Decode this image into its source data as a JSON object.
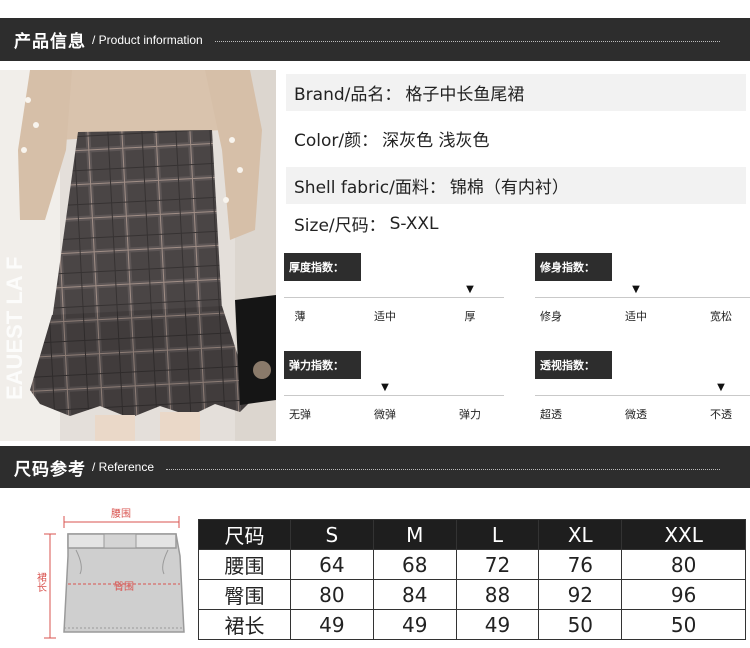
{
  "sections": {
    "product_info": {
      "title_cn": "产品信息",
      "title_en": "/ Product information"
    },
    "reference": {
      "title_cn": "尺码参考",
      "title_en": "/ Reference"
    }
  },
  "info_rows": [
    {
      "label": "Brand/品名：",
      "value": "格子中长鱼尾裙"
    },
    {
      "label": "Color/颜：",
      "value": " 深灰色 浅灰色"
    },
    {
      "label": "Shell fabric/面料：",
      "value": "锦棉（有内衬）"
    },
    {
      "label": "Size/尺码：",
      "value": " S-XXL"
    }
  ],
  "photo": {
    "watermark": "EAUEST LA F"
  },
  "meters": [
    {
      "title": "厚度指数：",
      "levels": [
        "薄",
        "适中",
        "厚"
      ],
      "selected": 2,
      "marker": "▼"
    },
    {
      "title": "修身指数：",
      "levels": [
        "修身",
        "适中",
        "宽松"
      ],
      "selected": 1,
      "marker": "▼"
    },
    {
      "title": "弹力指数：",
      "levels": [
        "无弹",
        "微弹",
        "弹力"
      ],
      "selected": 1,
      "marker": "▼"
    },
    {
      "title": "透视指数：",
      "levels": [
        "超透",
        "微透",
        "不透"
      ],
      "selected": 2,
      "marker": "▼"
    }
  ],
  "diagram": {
    "waist": "腰围",
    "hip": "臀围",
    "length": "裙长"
  },
  "size_table": {
    "header": [
      "尺码",
      "S",
      "M",
      "L",
      "XL",
      "XXL"
    ],
    "rows": [
      [
        "腰围",
        "64",
        "68",
        "72",
        "76",
        "80"
      ],
      [
        "臀围",
        "80",
        "84",
        "88",
        "92",
        "96"
      ],
      [
        "裙长",
        "49",
        "49",
        "49",
        "50",
        "50"
      ]
    ]
  },
  "colors": {
    "bar_bg": "#2d2d2d",
    "diagram_red": "#d9534f",
    "skirt_gray": "#c8c8c8"
  }
}
